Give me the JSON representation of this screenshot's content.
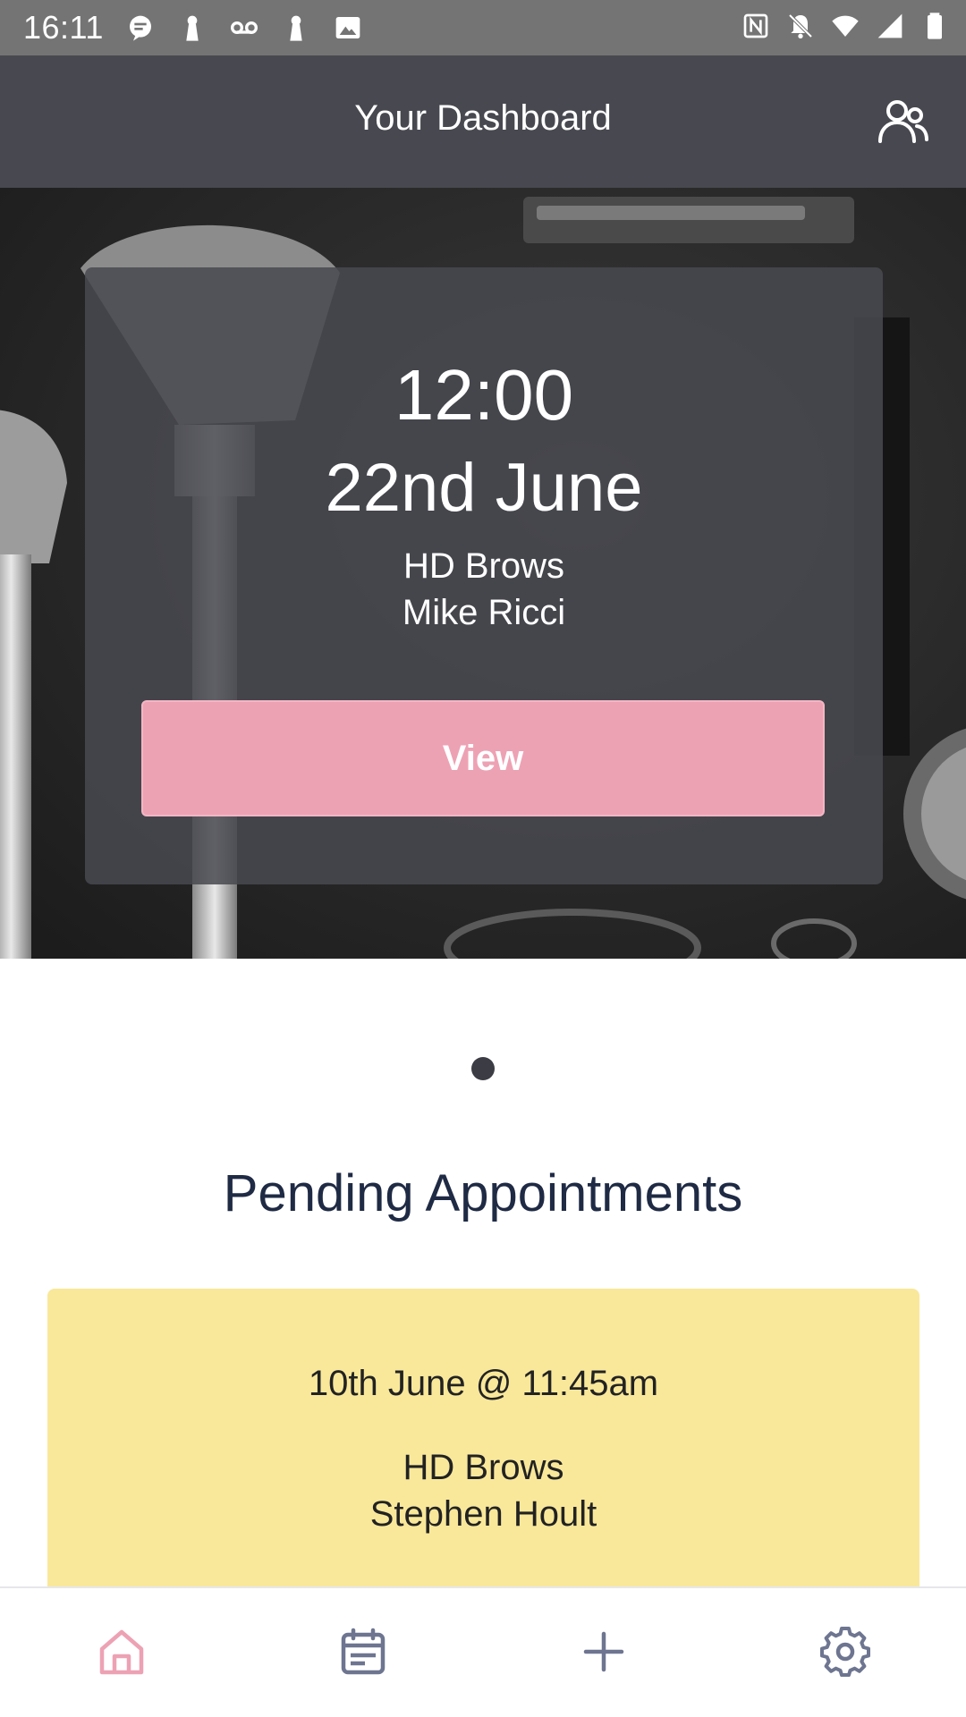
{
  "status_bar": {
    "time": "16:11",
    "left_icons": [
      "chat-icon",
      "keyhole-icon",
      "voicemail-icon",
      "keyhole-icon",
      "image-icon"
    ],
    "right_icons": [
      "nfc-icon",
      "bell-muted-icon",
      "wifi-icon",
      "cell-signal-icon",
      "battery-icon"
    ]
  },
  "app_bar": {
    "title": "Your Dashboard",
    "profile_icon": "people-icon"
  },
  "featured_appointment": {
    "time": "12:00",
    "date": "22nd June",
    "service": "HD Brows",
    "client": "Mike Ricci",
    "view_label": "View"
  },
  "pending": {
    "title": "Pending Appointments",
    "items": [
      {
        "datetime": "10th June @ 11:45am",
        "service": "HD Brows",
        "client": "Stephen Hoult"
      }
    ]
  },
  "bottom_nav": {
    "items": [
      {
        "icon": "home-icon",
        "active": true
      },
      {
        "icon": "calendar-icon",
        "active": false
      },
      {
        "icon": "plus-icon",
        "active": false
      },
      {
        "icon": "gear-icon",
        "active": false
      }
    ]
  },
  "colors": {
    "app_bar": "#474850",
    "accent_pink": "#eda2b4",
    "pending_yellow": "#f9e89a",
    "title_navy": "#1f2a44",
    "nav_inactive": "#6e7590"
  }
}
